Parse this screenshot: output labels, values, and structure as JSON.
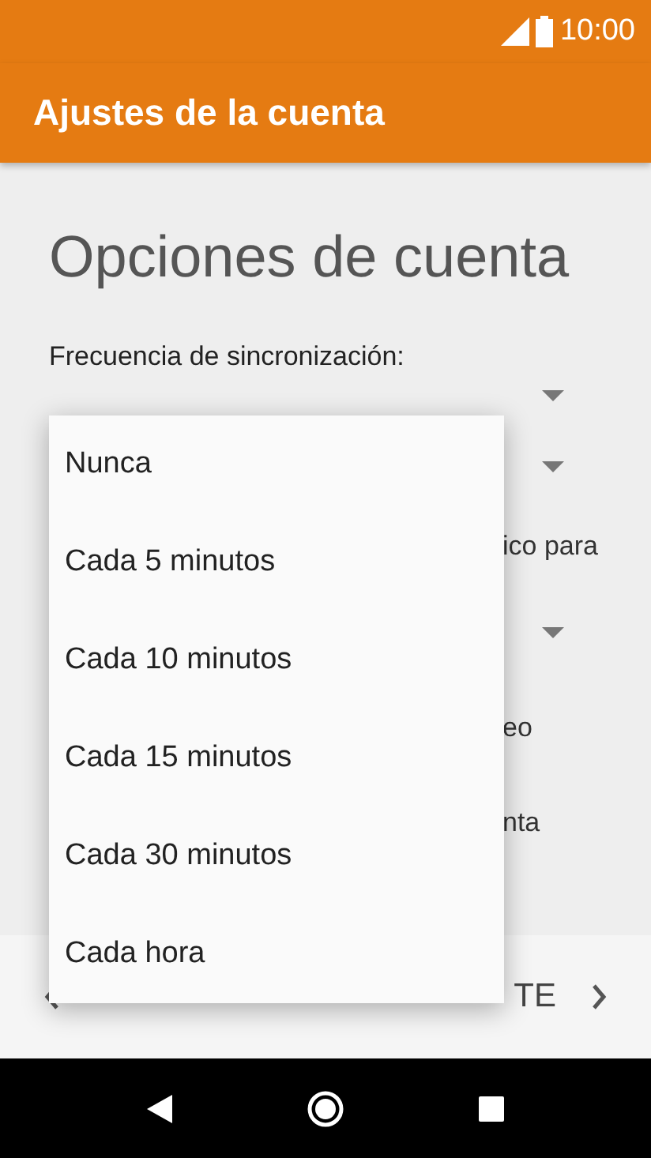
{
  "status_bar": {
    "time": "10:00"
  },
  "app_bar": {
    "title": "Ajustes de la cuenta"
  },
  "heading": "Opciones de cuenta",
  "sync_label": "Frecuencia de sincronización:",
  "background_rows": [
    {
      "kind": "spinner"
    },
    {
      "kind": "spinner"
    },
    {
      "kind": "text",
      "text": "ico para"
    },
    {
      "kind": "spinner"
    },
    {
      "kind": "text",
      "text": "eo"
    },
    {
      "kind": "text",
      "text": "nta"
    }
  ],
  "footer": {
    "next": "TE"
  },
  "menu": [
    {
      "label": "Nunca"
    },
    {
      "label": "Cada 5 minutos"
    },
    {
      "label": "Cada 10 minutos"
    },
    {
      "label": "Cada 15 minutos"
    },
    {
      "label": "Cada 30 minutos"
    },
    {
      "label": "Cada hora"
    }
  ]
}
